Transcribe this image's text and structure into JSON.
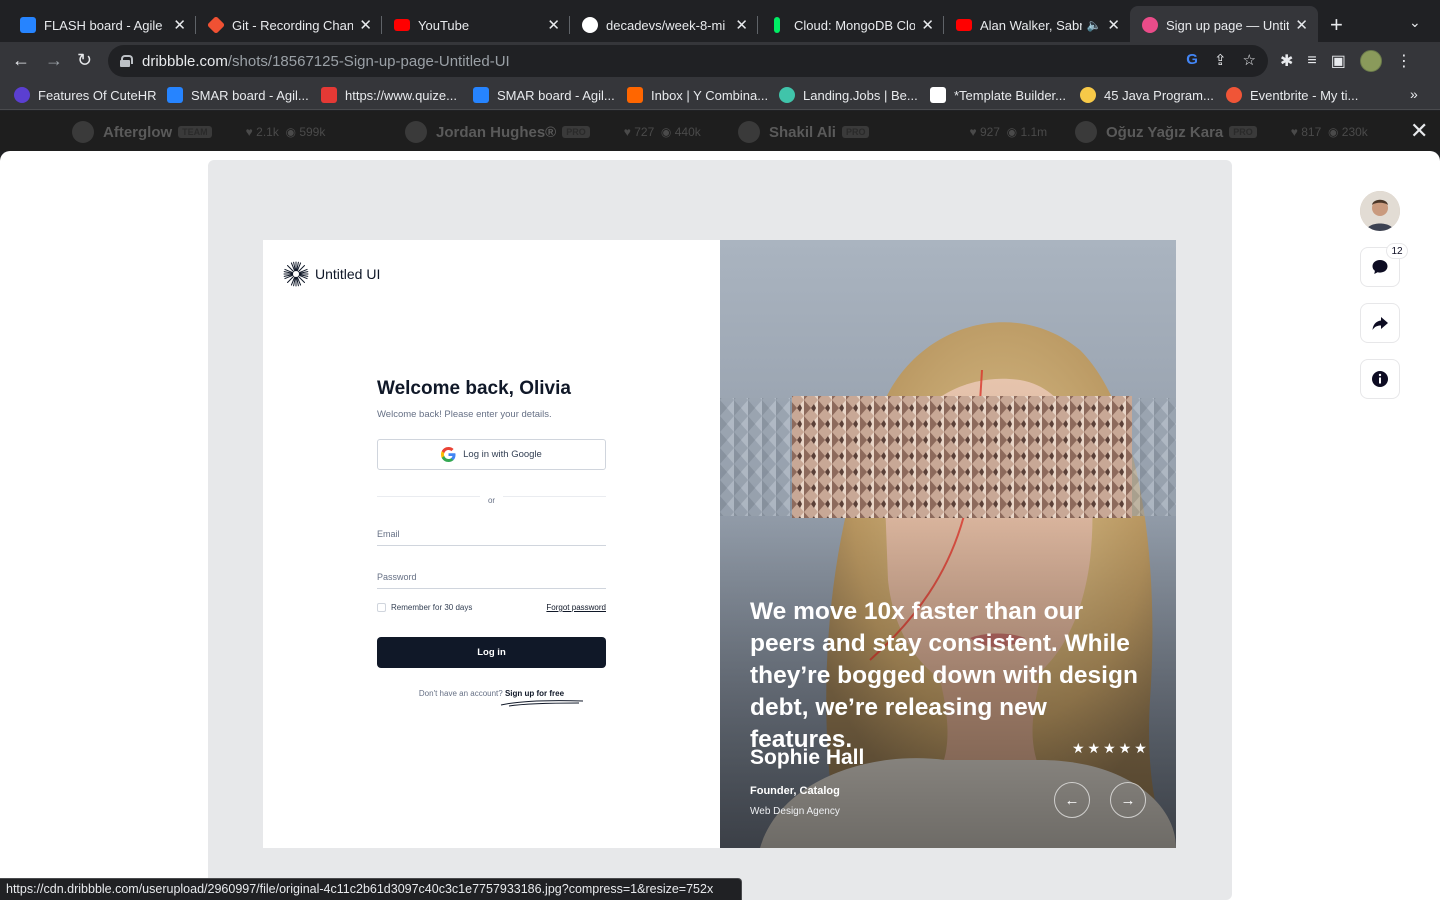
{
  "browser": {
    "tabs": [
      {
        "title": "FLASH board - Agile b",
        "favicon": "jira-icon",
        "color": "#2684ff"
      },
      {
        "title": "Git - Recording Chang",
        "favicon": "git-icon",
        "color": "#f05133"
      },
      {
        "title": "YouTube",
        "favicon": "youtube-icon",
        "color": "#ff0000"
      },
      {
        "title": "decadevs/week-8-mi",
        "favicon": "github-icon",
        "color": "#ffffff"
      },
      {
        "title": "Cloud: MongoDB Clou",
        "favicon": "mongodb-icon",
        "color": "#00ed64"
      },
      {
        "title": "Alan Walker, Sabr",
        "favicon": "youtube-icon",
        "color": "#ff0000"
      },
      {
        "title": "Sign up page — Untitl",
        "favicon": "dribbble-icon",
        "color": "#ea4c89"
      }
    ],
    "url_domain": "dribbble.com",
    "url_path": "/shots/18567125-Sign-up-page-Untitled-UI",
    "bookmarks": [
      {
        "label": "Features Of CuteHR",
        "color": "#5b3fd1"
      },
      {
        "label": "SMAR board - Agil...",
        "color": "#2684ff"
      },
      {
        "label": "https://www.quize...",
        "color": "#e53935"
      },
      {
        "label": "SMAR board - Agil...",
        "color": "#2684ff"
      },
      {
        "label": "Inbox | Y Combina...",
        "color": "#ff6600"
      },
      {
        "label": "Landing.Jobs | Be...",
        "color": "#40c4aa"
      },
      {
        "label": "*Template Builder...",
        "color": "#ffffff"
      },
      {
        "label": "45 Java Program...",
        "color": "#f7c948"
      },
      {
        "label": "Eventbrite - My ti...",
        "color": "#f05537"
      }
    ],
    "status_url": "https://cdn.dribbble.com/userupload/2960997/file/original-4c11c2b61d3097c40c3c1e7757933186.jpg?compress=1&resize=752x"
  },
  "designers": [
    {
      "name": "Afterglow",
      "badge": "TEAM",
      "likes": "2.1k",
      "views": "599k"
    },
    {
      "name": "Jordan Hughes®",
      "badge": "PRO",
      "likes": "727",
      "views": "440k"
    },
    {
      "name": "Shakil Ali",
      "badge": "PRO",
      "likes": "927",
      "views": "1.1m"
    },
    {
      "name": "Oğuz Yağız Kara",
      "badge": "PRO",
      "likes": "817",
      "views": "230k"
    }
  ],
  "shot": {
    "brand": "Untitled UI",
    "heading": "Welcome back, Olivia",
    "subheading": "Welcome back! Please enter your details.",
    "google_button": "Log in with Google",
    "divider": "or",
    "email_label": "Email",
    "password_label": "Password",
    "remember": "Remember for 30 days",
    "forgot": "Forgot password",
    "login_button": "Log in",
    "signup_prompt": "Don't have an account?",
    "signup_link": "Sign up for free",
    "quote": "We move 10x faster than our peers and stay consistent. While they’re bogged down with design debt, we’re releasing new features.",
    "person_name": "Sophie Hall",
    "person_role": "Founder, Catalog",
    "person_org": "Web Design Agency",
    "rating_stars": 5,
    "stars_text": "★★★★★",
    "prev_arrow": "←",
    "next_arrow": "→"
  },
  "sidebar": {
    "comment_count": "12"
  }
}
